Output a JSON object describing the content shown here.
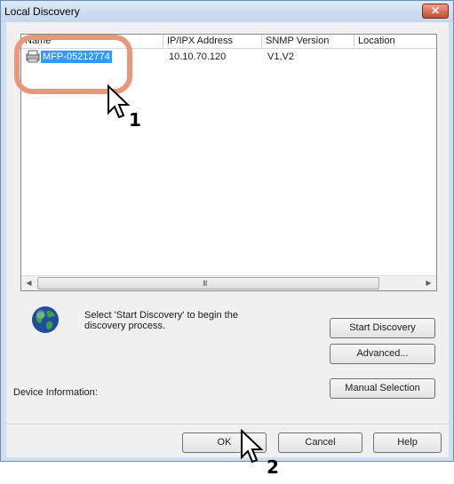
{
  "window": {
    "title": "Local Discovery",
    "close_glyph": "✕"
  },
  "list": {
    "columns": [
      "Name",
      "IP/IPX Address",
      "SNMP Version",
      "Location"
    ],
    "rows": [
      {
        "name": "MFP-05212774",
        "address": "10.10.70.120",
        "snmp": "V1,V2",
        "location": ""
      }
    ],
    "scroll_grip": "III"
  },
  "status": {
    "text": "Select 'Start Discovery' to begin the discovery process."
  },
  "buttons": {
    "start_discovery": "Start Discovery",
    "advanced": "Advanced...",
    "manual_selection": "Manual Selection",
    "ok": "OK",
    "cancel": "Cancel",
    "help": "Help"
  },
  "device_info_label": "Device Information:",
  "callouts": {
    "step1": "1",
    "step2": "2"
  },
  "colors": {
    "selection": "#3399ff",
    "highlight_ring": "#e9967a"
  },
  "icons": {
    "printer": "printer-icon",
    "globe": "globe-icon",
    "cursor": "arrow-cursor-icon"
  }
}
